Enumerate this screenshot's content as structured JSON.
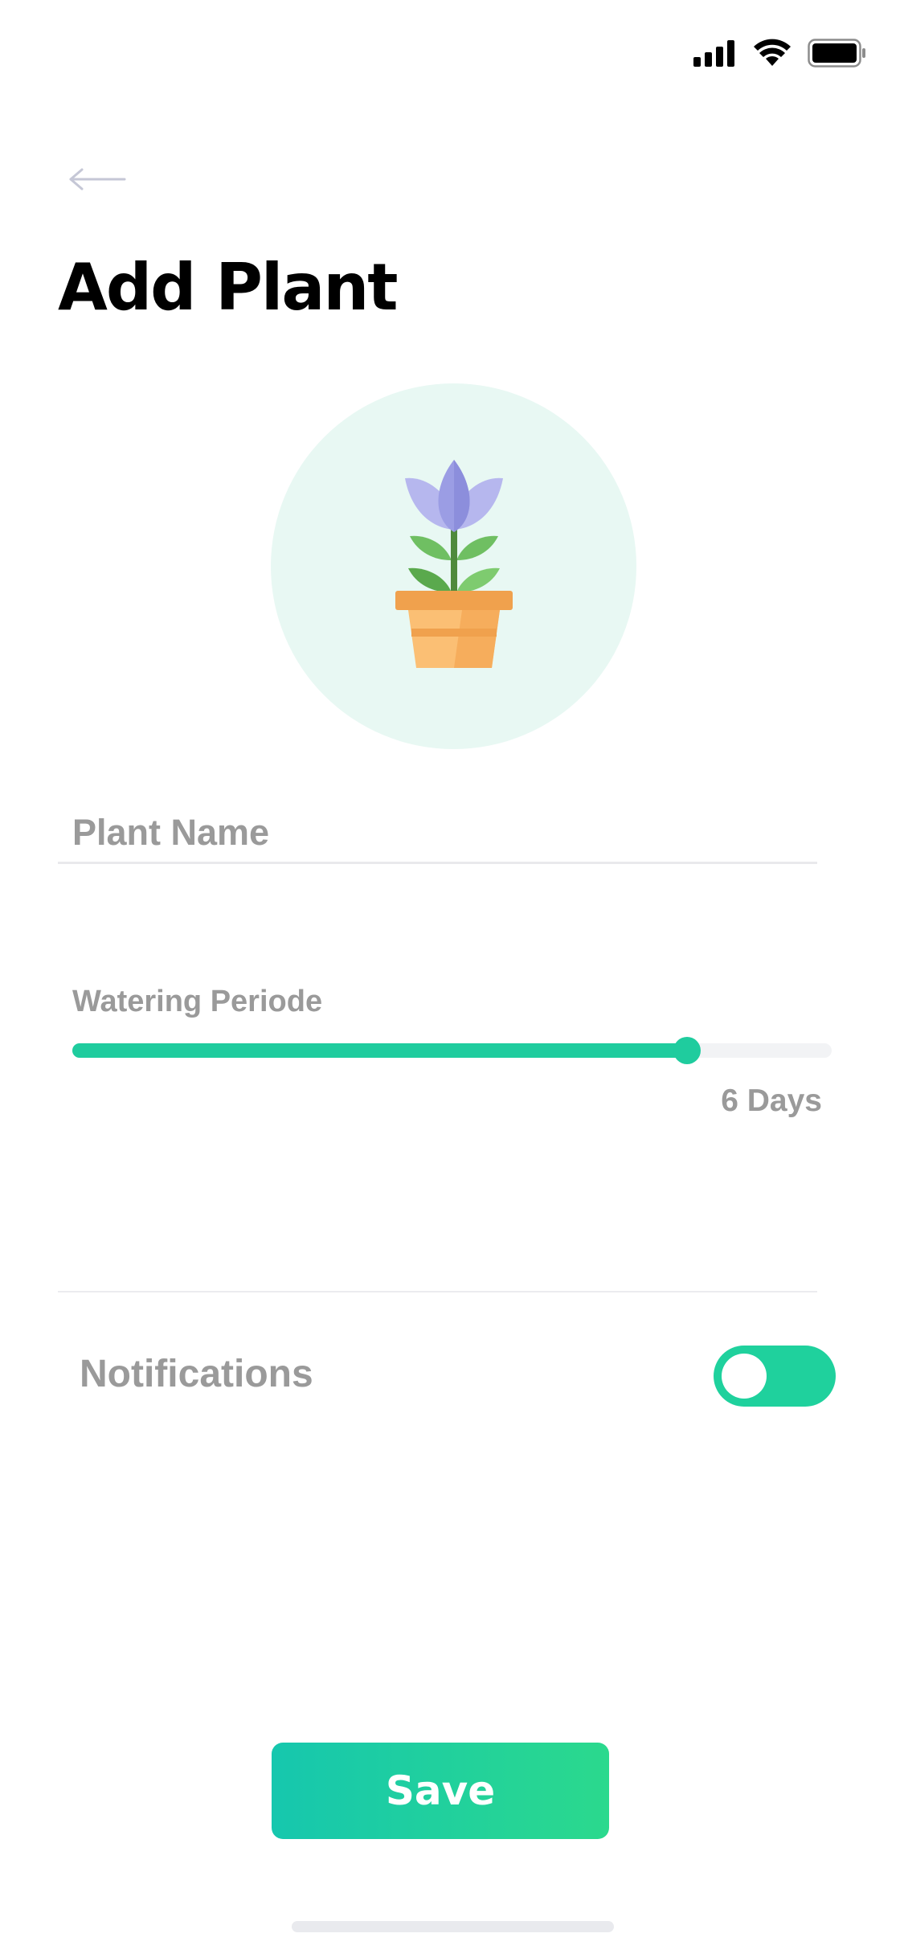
{
  "status_bar": {
    "icons": [
      "cellular-signal-icon",
      "wifi-icon",
      "battery-icon"
    ]
  },
  "header": {
    "back_icon": "arrow-left-icon",
    "title": "Add Plant"
  },
  "plant_avatar": {
    "icon": "potted-plant-icon",
    "background_color": "#e8f8f3"
  },
  "form": {
    "plant_name": {
      "value": "",
      "placeholder": "Plant Name"
    },
    "watering": {
      "label": "Watering Periode",
      "value_label": "6 Days",
      "fill_fraction": 0.81
    },
    "notifications": {
      "label": "Notifications",
      "enabled": true
    }
  },
  "actions": {
    "save_label": "Save"
  },
  "colors": {
    "accent": "#1fcc9e",
    "accent_gradient_start": "#16c7ae",
    "accent_gradient_end": "#2bd98d",
    "muted_text": "#9a9a9a"
  }
}
